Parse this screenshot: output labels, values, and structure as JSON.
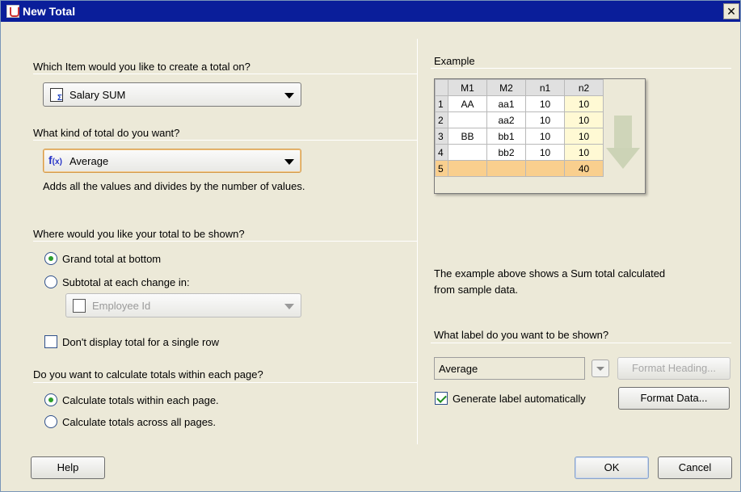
{
  "window": {
    "title": "New Total"
  },
  "left": {
    "item_question": "Which Item would you like to create a total on?",
    "item_combo": {
      "value": "Salary SUM",
      "icon": "measure-sum-icon"
    },
    "kind_question": "What kind of total do you want?",
    "kind_combo": {
      "value": "Average",
      "icon": "function-fx-icon"
    },
    "kind_description": "Adds all the values and divides by the number of values.",
    "where_question": "Where would you like your total to be shown?",
    "where_options": [
      {
        "label": "Grand total at bottom",
        "checked": true
      },
      {
        "label": "Subtotal at each change in:",
        "checked": false
      }
    ],
    "subtotal_combo": {
      "value": "Employee Id",
      "icon": "dimension-key-icon",
      "disabled": true
    },
    "single_row_check": {
      "label": "Don't display total for a single row",
      "checked": false
    },
    "page_question": "Do you want to calculate totals within each page?",
    "page_options": [
      {
        "label": "Calculate totals within each page.",
        "checked": true
      },
      {
        "label": "Calculate totals across all pages.",
        "checked": false
      }
    ]
  },
  "right": {
    "example_label": "Example",
    "example_table": {
      "headers": [
        "",
        "M1",
        "M2",
        "n1",
        "n2"
      ],
      "rows": [
        [
          "1",
          "AA",
          "aa1",
          "10",
          "10"
        ],
        [
          "2",
          "",
          "aa2",
          "10",
          "10"
        ],
        [
          "3",
          "BB",
          "bb1",
          "10",
          "10"
        ],
        [
          "4",
          "",
          "bb2",
          "10",
          "10"
        ],
        [
          "5",
          "",
          "",
          "",
          "40"
        ]
      ]
    },
    "example_note_line1": "The example above shows a Sum total calculated",
    "example_note_line2": "from sample data.",
    "label_question": "What label do you want to be shown?",
    "label_value": "Average",
    "format_heading_button": "Format Heading...",
    "auto_label_check": {
      "label": "Generate label automatically",
      "checked": true
    },
    "format_data_button": "Format Data..."
  },
  "buttons": {
    "help": "Help",
    "ok": "OK",
    "cancel": "Cancel"
  },
  "colors": {
    "titlebar": "#0a1e9a",
    "dialog_bg": "#ece9d8",
    "total_row": "#f9cf8e",
    "n2_column": "#fff9d4"
  }
}
